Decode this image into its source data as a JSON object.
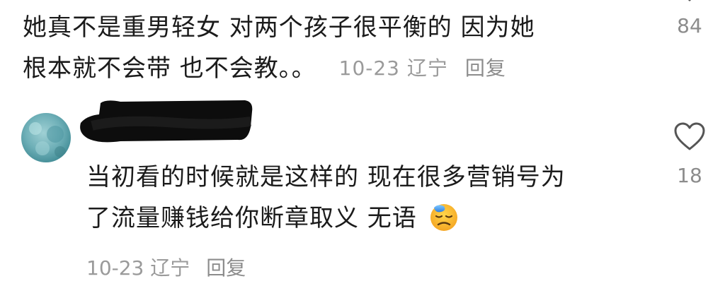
{
  "comment1": {
    "line1": "她真不是重男轻女  对两个孩子很平衡的  因为她",
    "line2": "根本就不会带  也不会教。。",
    "date": "10-23",
    "location": "辽宁",
    "reply_label": "回复",
    "likes": "84",
    "heart_icon": "heart-outline-icon"
  },
  "comment2": {
    "username_redacted": true,
    "line1": "当初看的时候就是这样的  现在很多营销号为",
    "line2": "了流量赚钱给你断章取义  无语",
    "emoji": "downcast-sweat-emoji",
    "date": "10-23",
    "location": "辽宁",
    "reply_label": "回复",
    "likes": "18",
    "heart_icon": "heart-outline-icon"
  },
  "colors": {
    "text": "#1b1b1b",
    "meta": "#9a9a9a",
    "heart": "#555555",
    "avatar": "#7fb8bf"
  }
}
